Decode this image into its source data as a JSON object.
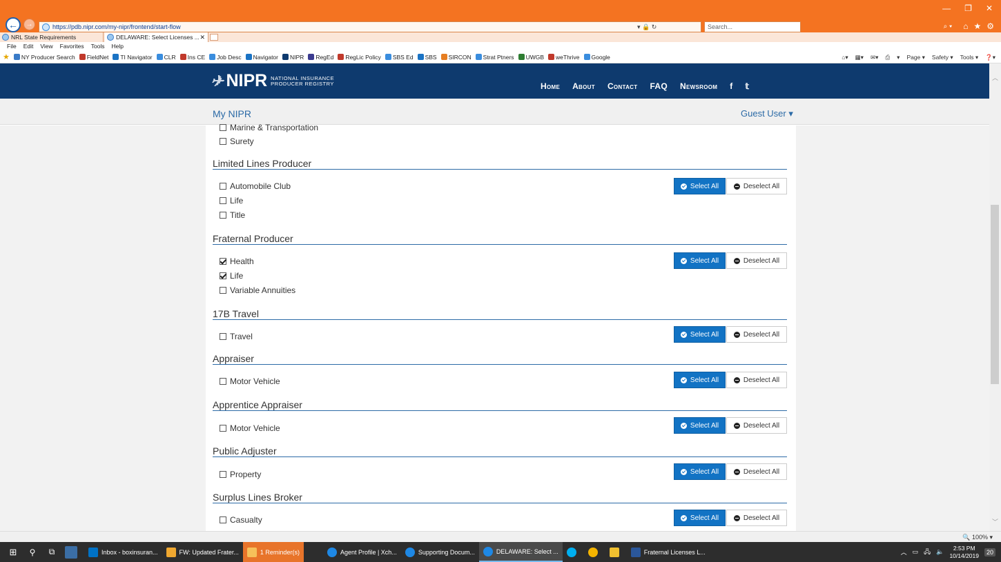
{
  "browser": {
    "url": "https://pdb.nipr.com/my-nipr/frontend/start-flow",
    "search_placeholder": "Search...",
    "address_controls": "▾ 🔒 ↻",
    "tabs": [
      {
        "label": "NRL State Requirements"
      },
      {
        "label": "DELAWARE: Select Licenses ...",
        "active": true
      }
    ],
    "tab_close": "✕",
    "window_controls": {
      "minimize": "—",
      "maximize": "❐",
      "close": "✕"
    },
    "right_icons": {
      "search": "⌕ ▾",
      "home": "⌂",
      "star": "★",
      "gear": "⚙"
    },
    "menu": [
      "File",
      "Edit",
      "View",
      "Favorites",
      "Tools",
      "Help"
    ],
    "favorites": [
      {
        "label": "NY Producer Search",
        "color": "#3a7bc8"
      },
      {
        "label": "FieldNet",
        "color": "#c0392b"
      },
      {
        "label": "TI Navigator",
        "color": "#1a73c4"
      },
      {
        "label": "CLR",
        "color": "#3a8dde"
      },
      {
        "label": "Ins CE",
        "color": "#c0392b"
      },
      {
        "label": "Job Desc",
        "color": "#3a8dde"
      },
      {
        "label": "Navigator",
        "color": "#1a73c4"
      },
      {
        "label": "NIPR",
        "color": "#0e3a6e"
      },
      {
        "label": "RegEd",
        "color": "#3b3b8f"
      },
      {
        "label": "RegLic Policy",
        "color": "#c0392b"
      },
      {
        "label": "SBS Ed",
        "color": "#3a8dde"
      },
      {
        "label": "SBS",
        "color": "#1a73c4"
      },
      {
        "label": "SIRCON",
        "color": "#e67e22"
      },
      {
        "label": "Strat Ptners",
        "color": "#3a8dde"
      },
      {
        "label": "UWGB",
        "color": "#2e7d32"
      },
      {
        "label": "weThrive",
        "color": "#c0392b"
      },
      {
        "label": "Google",
        "color": "#3a8dde"
      }
    ],
    "command_bar": [
      "▾",
      "Page ▾",
      "Safety ▾",
      "Tools ▾",
      "❓▾"
    ],
    "zoom": "🔍 100%  ▾"
  },
  "site": {
    "logo_name": "NIPR",
    "logo_tagline_1": "NATIONAL INSURANCE",
    "logo_tagline_2": "PRODUCER REGISTRY",
    "nav": [
      "Home",
      "About",
      "Contact",
      "FAQ",
      "Newsroom"
    ],
    "social": {
      "facebook": "f",
      "twitter": "𝕥"
    },
    "subheader_title": "My NIPR",
    "user_menu": "Guest User ▾",
    "select_all": "Select All",
    "deselect_all": "Deselect All"
  },
  "top_items": [
    "Marine & Transportation",
    "Surety"
  ],
  "sections": [
    {
      "title": "Limited Lines Producer",
      "items": [
        {
          "label": "Automobile Club",
          "checked": false
        },
        {
          "label": "Life",
          "checked": false
        },
        {
          "label": "Title",
          "checked": false
        }
      ]
    },
    {
      "title": "Fraternal Producer",
      "items": [
        {
          "label": "Health",
          "checked": true
        },
        {
          "label": "Life",
          "checked": true
        },
        {
          "label": "Variable Annuities",
          "checked": false
        }
      ]
    },
    {
      "title": "17B Travel",
      "items": [
        {
          "label": "Travel",
          "checked": false
        }
      ]
    },
    {
      "title": "Appraiser",
      "items": [
        {
          "label": "Motor Vehicle",
          "checked": false
        }
      ]
    },
    {
      "title": "Apprentice Appraiser",
      "items": [
        {
          "label": "Motor Vehicle",
          "checked": false
        }
      ]
    },
    {
      "title": "Public Adjuster",
      "items": [
        {
          "label": "Property",
          "checked": false
        }
      ]
    },
    {
      "title": "Surplus Lines Broker",
      "items": [
        {
          "label": "Casualty",
          "checked": false
        }
      ]
    }
  ],
  "taskbar": {
    "apps": [
      {
        "label": "Inbox - boxinsuran...",
        "color": "#0072c6"
      },
      {
        "label": "FW: Updated Frater...",
        "color": "#f0a830"
      },
      {
        "label": "1 Reminder(s)",
        "color": "#f0a830"
      },
      {
        "label": "Agent Profile | Xch...",
        "color": "#1e88e5"
      },
      {
        "label": "Supporting Docum...",
        "color": "#1e88e5"
      },
      {
        "label": "DELAWARE: Select ...",
        "color": "#1e88e5",
        "active": true
      },
      {
        "label": "",
        "color": "#00aff0"
      },
      {
        "label": "",
        "color": "#f4b400"
      },
      {
        "label": "",
        "color": "#f0c030"
      },
      {
        "label": "Fraternal Licenses L...",
        "color": "#2b579a"
      }
    ],
    "time": "2:53 PM",
    "date": "10/14/2019",
    "notifications": "20"
  }
}
